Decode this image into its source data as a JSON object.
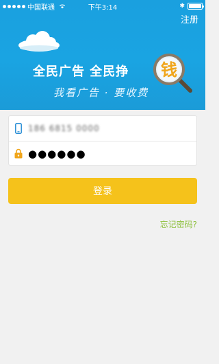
{
  "status_bar": {
    "carrier": "中国联通",
    "time": "下午3:14",
    "bluetooth": "✱"
  },
  "header": {
    "register_label": "注册",
    "slogan": "全民广告 全民挣",
    "slogan_highlight": "钱",
    "sub_slogan": "我看广告 · 要收费"
  },
  "form": {
    "phone_value": "186 6815 0000",
    "password_mask": "●●●●●●"
  },
  "actions": {
    "login_label": "登录",
    "forgot_label": "忘记密码?"
  },
  "colors": {
    "banner": "#1aa0df",
    "login_button": "#f5c21b",
    "forgot_link": "#8dc03c",
    "background": "#f1f1f1"
  }
}
